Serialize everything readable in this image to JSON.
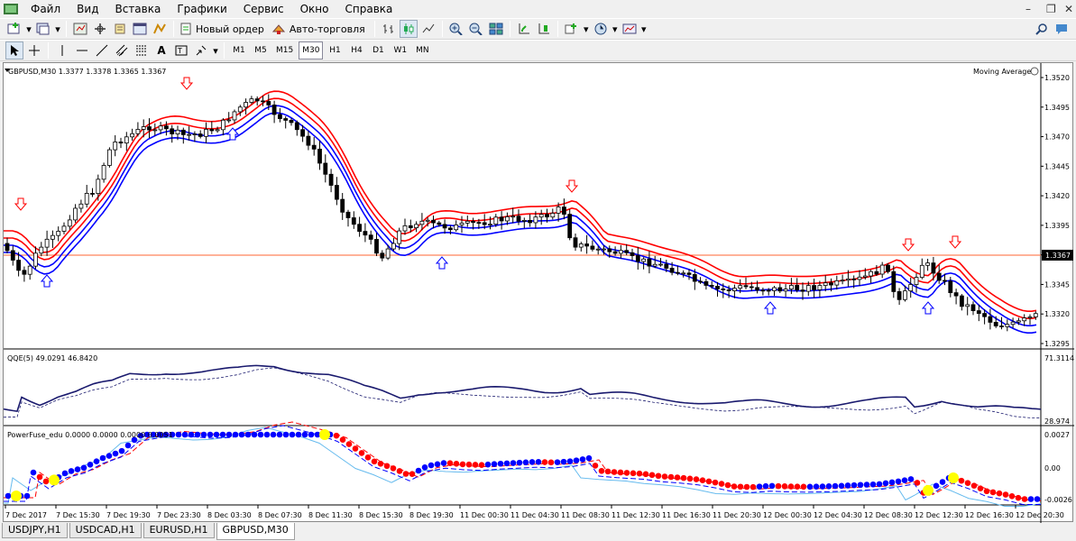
{
  "menu": [
    "Файл",
    "Вид",
    "Вставка",
    "Графики",
    "Сервис",
    "Окно",
    "Справка"
  ],
  "toolbar": {
    "new_order_label": "Новый ордер",
    "autotrading_label": "Авто-торговля"
  },
  "timeframes": [
    "M1",
    "M5",
    "M15",
    "M30",
    "H1",
    "H4",
    "D1",
    "W1",
    "MN"
  ],
  "active_timeframe": "M30",
  "chart": {
    "header": "GBPUSD,M30  1.3377 1.3378 1.3365 1.3367",
    "indicator_name": "Moving Average",
    "price_labels": [
      "1.3520",
      "1.3495",
      "1.3470",
      "1.3445",
      "1.3420",
      "1.3395",
      "1.3370",
      "1.3345",
      "1.3320",
      "1.3295"
    ],
    "current_price": "1.3367",
    "qqe_header": "QQE(5) 49.0291 46.8420",
    "qqe_labels": [
      "71.3114",
      "28.974"
    ],
    "pf_header": "PowerFuse_edu 0.0000 0.0000 0.0000 0.0051",
    "pf_labels": [
      "0.0027",
      "0.00",
      "-0.0026"
    ],
    "time_labels": [
      "7 Dec 2017",
      "7 Dec 15:30",
      "7 Dec 19:30",
      "7 Dec 23:30",
      "8 Dec 03:30",
      "8 Dec 07:30",
      "8 Dec 11:30",
      "8 Dec 15:30",
      "8 Dec 19:30",
      "11 Dec 00:30",
      "11 Dec 04:30",
      "11 Dec 08:30",
      "11 Dec 12:30",
      "11 Dec 16:30",
      "11 Dec 20:30",
      "12 Dec 00:30",
      "12 Dec 04:30",
      "12 Dec 08:30",
      "12 Dec 12:30",
      "12 Dec 16:30",
      "12 Dec 20:30"
    ]
  },
  "tabs": [
    "USDJPY,H1",
    "USDCAD,H1",
    "EURUSD,H1",
    "GBPUSD,M30"
  ],
  "active_tab": "GBPUSD,M30",
  "colors": {
    "bull_candle": "#ffffff",
    "bear_candle": "#000000",
    "envelope_upper": "#ff0000",
    "envelope_lower": "#0000ff",
    "qqe_line": "#1a1a6e",
    "pf_red": "#ff0000",
    "pf_blue": "#0000ff",
    "pf_yellow": "#ffff00",
    "price_line": "#ff6633"
  }
}
